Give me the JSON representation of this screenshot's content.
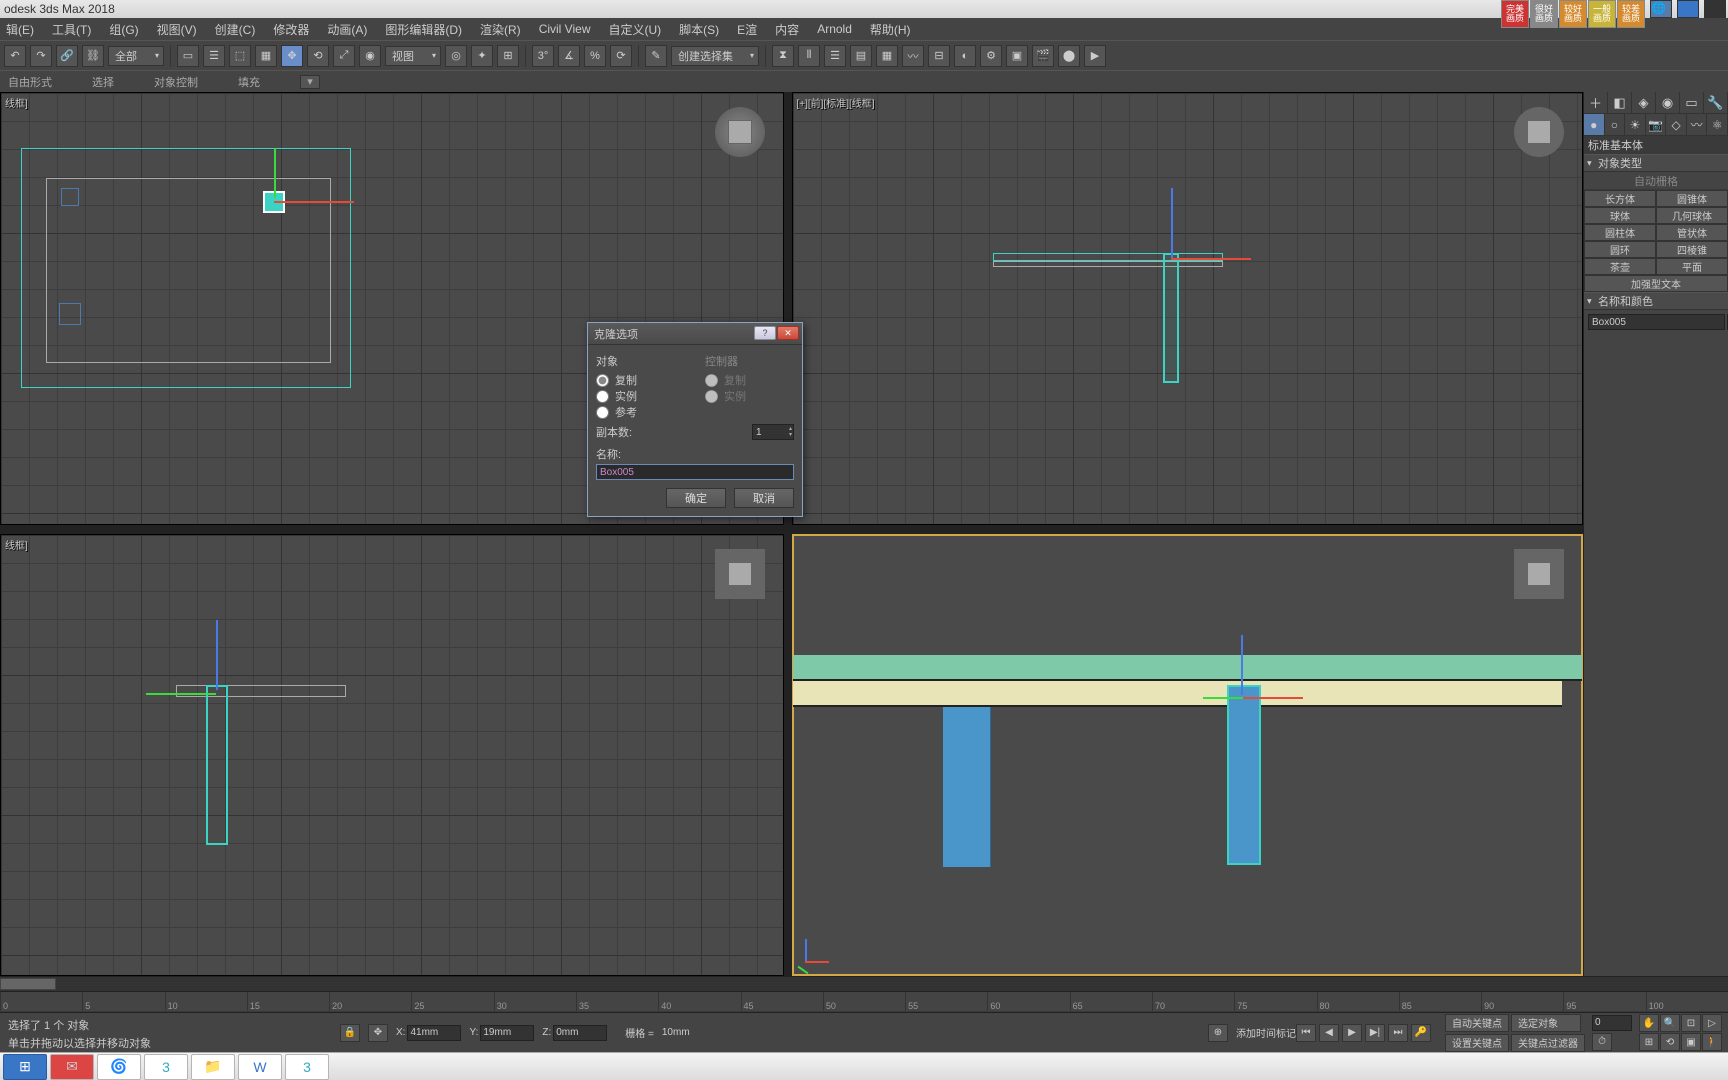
{
  "title": "odesk 3ds Max 2018",
  "badges": [
    "完美\n画质",
    "很好\n画质",
    "较好\n画质",
    "一般\n画质",
    "较差\n画质"
  ],
  "menu": [
    "辑(E)",
    "工具(T)",
    "组(G)",
    "视图(V)",
    "创建(C)",
    "修改器",
    "动画(A)",
    "图形编辑器(D)",
    "渲染(R)",
    "Civil View",
    "自定义(U)",
    "脚本(S)",
    "E渲",
    "内容",
    "Arnold",
    "帮助(H)"
  ],
  "toolbar": {
    "all": "全部",
    "viewdrop": "视图",
    "createset": "创建选择集"
  },
  "ribbon": [
    "自由形式",
    "选择",
    "对象控制",
    "填充"
  ],
  "viewports": {
    "top": "线框]",
    "front": "[+][前][标准][线框]",
    "left": "线框]",
    "persp": ""
  },
  "panel": {
    "stdprim": "标准基本体",
    "objtype": "对象类型",
    "autogrid": "自动栅格",
    "btns": [
      [
        "长方体",
        "圆锥体"
      ],
      [
        "球体",
        "几何球体"
      ],
      [
        "圆柱体",
        "管状体"
      ],
      [
        "圆环",
        "四棱锥"
      ],
      [
        "茶壶",
        "平面"
      ]
    ],
    "plus": "加强型文本",
    "namecolor": "名称和颜色",
    "name": "Box005"
  },
  "dialog": {
    "title": "克隆选项",
    "object": "对象",
    "controller": "控制器",
    "copy": "复制",
    "instance": "实例",
    "reference": "参考",
    "copies_label": "副本数:",
    "copies": "1",
    "name_label": "名称:",
    "name": "Box005",
    "ok": "确定",
    "cancel": "取消"
  },
  "status": {
    "sel": "选择了 1 个 对象",
    "hint": "单击并拖动以选择并移动对象",
    "x": "41mm",
    "y": "19mm",
    "z": "0mm",
    "grid_label": "栅格 =",
    "grid": "10mm",
    "addmark": "添加时间标记",
    "autokey": "自动关键点",
    "selobj": "选定对象",
    "setkey": "设置关键点",
    "keyfilter": "关键点过滤器",
    "frame": "0"
  },
  "timeline": [
    "0",
    "5",
    "10",
    "15",
    "20",
    "25",
    "30",
    "35",
    "40",
    "45",
    "50",
    "55",
    "60",
    "65",
    "70",
    "75",
    "80",
    "85",
    "90",
    "95",
    "100"
  ]
}
